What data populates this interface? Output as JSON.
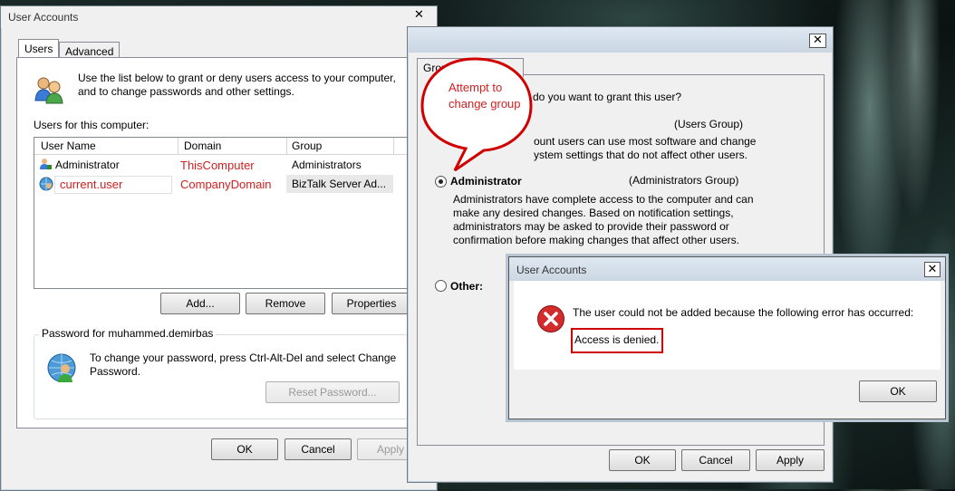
{
  "user_accounts": {
    "title": "User Accounts",
    "tabs": [
      "Users",
      "Advanced"
    ],
    "intro": "Use the list below to grant or deny users access to your computer, and to change passwords and other settings.",
    "users_label": "Users for this computer:",
    "columns": [
      "User Name",
      "Domain",
      "Group"
    ],
    "rows": [
      {
        "name": "Administrator",
        "domain": "ThisComputer",
        "group": "Administrators"
      },
      {
        "name": "current.user",
        "domain": "CompanyDomain",
        "group": "BizTalk Server Ad..."
      }
    ],
    "buttons": {
      "add": "Add...",
      "remove": "Remove",
      "properties": "Properties"
    },
    "password_group": "Password for muhammed.demirbas",
    "password_text": "To change your password, press Ctrl-Alt-Del and select Change Password.",
    "reset_password": "Reset Password...",
    "footer": {
      "ok": "OK",
      "cancel": "Cancel",
      "apply": "Apply"
    }
  },
  "properties": {
    "tab": "Group",
    "question": "do you want to grant this user?",
    "standard_group": "(Users Group)",
    "standard_desc": "ount users can use most software and change\nystem settings that do not affect other users.",
    "admin_label": "Administrator",
    "admin_group": "(Administrators Group)",
    "admin_desc": "Administrators have complete access to the computer and can make any desired changes. Based on notification settings, administrators may be asked to provide their password or confirmation before making changes that affect other users.",
    "other_label": "Other:",
    "footer": {
      "ok": "OK",
      "cancel": "Cancel",
      "apply": "Apply"
    }
  },
  "callout": {
    "text": "Attempt to change group"
  },
  "error_dialog": {
    "title": "User Accounts",
    "message": "The user could not be added because the following error has occurred:",
    "detail": "Access is denied.",
    "ok": "OK"
  },
  "colors": {
    "annotation_red": "#d02020",
    "title_bar": "#cbd7e3"
  }
}
